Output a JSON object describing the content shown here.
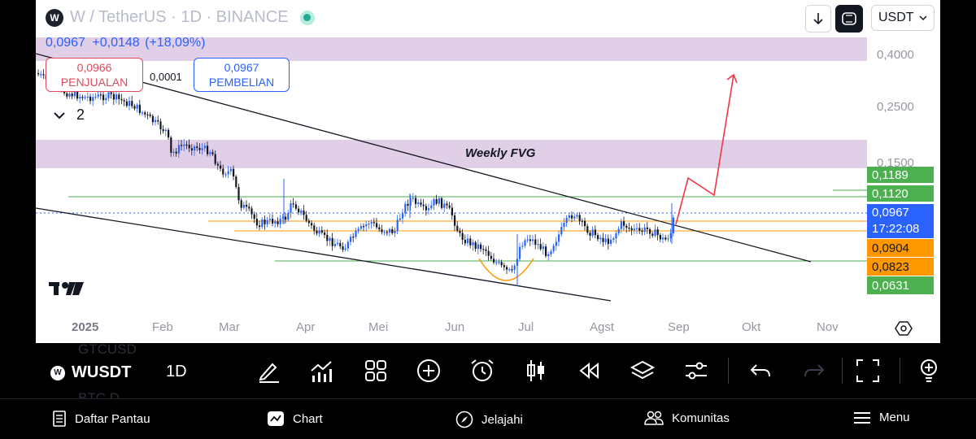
{
  "header": {
    "symbol_title": "W / TetherUS · 1D · BINANCE",
    "logo_glyph": "W",
    "last_price": "0,0967",
    "change_abs": "+0,0148",
    "change_pct": "(+18,09%)",
    "currency": "USDT"
  },
  "order": {
    "sell_price": "0,0966",
    "sell_label": "PENJUALAN",
    "spread": "0,0001",
    "buy_price": "0,0967",
    "buy_label": "PEMBELIAN"
  },
  "indicators_count": "2",
  "annotation": "Weekly FVG",
  "price_axis": {
    "ticks": [
      "0,4000",
      "0,2500",
      "0,1500"
    ],
    "labels": [
      {
        "value": "0,1189",
        "color": "#4caf50"
      },
      {
        "value": "0,1120",
        "color": "#4caf50"
      },
      {
        "value": "0,0967",
        "color": "#2962ff"
      },
      {
        "value": "0,0904",
        "color": "#ff9800"
      },
      {
        "value": "0,0823",
        "color": "#ff9800"
      },
      {
        "value": "0,0631",
        "color": "#4caf50"
      }
    ],
    "countdown": "17:22:08"
  },
  "time_axis": [
    "2025",
    "Feb",
    "Mar",
    "Apr",
    "Mei",
    "Jun",
    "Jul",
    "Agst",
    "Sep",
    "Okt",
    "Nov"
  ],
  "toolbar": {
    "symbol": "WUSDT",
    "interval": "1D",
    "ghost_top": "GTCUSD",
    "ghost_bottom": "BTC.D"
  },
  "tools": [
    "pencil-icon",
    "indicators-icon",
    "grid-icon",
    "add-icon",
    "alarm-icon",
    "candles-icon",
    "replay-icon",
    "layers-icon",
    "settings-sliders-icon",
    "undo-icon",
    "redo-icon",
    "fullscreen-icon",
    "bulb-icon"
  ],
  "nav": {
    "watchlist": "Daftar Pantau",
    "chart": "Chart",
    "explore": "Jelajahi",
    "community": "Komunitas",
    "menu": "Menu"
  },
  "colors": {
    "up": "#2962ff",
    "down": "#131722",
    "zone": "#d7bfe0",
    "support": "#4caf50",
    "orange": "#ff9800",
    "arrow": "#f23645"
  }
}
